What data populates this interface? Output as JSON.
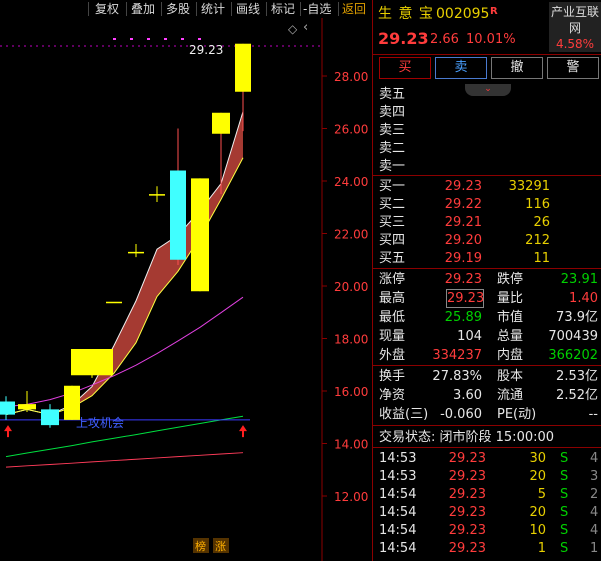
{
  "toolbar": {
    "items": [
      "复权",
      "叠加",
      "多股",
      "统计",
      "画线",
      "标记",
      "-自选",
      "返回"
    ]
  },
  "chart_data": {
    "type": "candlestick",
    "y_ticks": [
      "28.00",
      "26.00",
      "24.00",
      "22.00",
      "20.00",
      "18.00",
      "16.00",
      "14.00",
      "12.00"
    ],
    "ylim": [
      11,
      29.7
    ],
    "last_price_label": "29.23",
    "annotation": "上攻机会",
    "bottom_tags": [
      "榜",
      "涨"
    ],
    "colors": {
      "up": "#ffff00",
      "down": "#40ffff",
      "ribbon": "#a53a32",
      "ma_pink": "#e040e0",
      "ma_green": "#00e040",
      "ma_red": "#ff3c5a",
      "line_blue": "#3a3aff",
      "arrow": "#ff2020"
    },
    "candles": [
      {
        "o": 15.6,
        "c": 15.1,
        "h": 15.8,
        "l": 14.9
      },
      {
        "o": 15.3,
        "c": 15.5,
        "h": 16.0,
        "l": 15.2
      },
      {
        "o": 15.3,
        "c": 14.7,
        "h": 15.5,
        "l": 14.6
      },
      {
        "o": 14.9,
        "c": 16.2,
        "h": 16.2,
        "l": 14.9
      },
      {
        "o": 16.6,
        "c": 17.6,
        "h": 17.6,
        "l": 16.5
      },
      {
        "o": 19.4,
        "c": 19.4,
        "h": 19.4,
        "l": 19.4
      },
      {
        "o": 21.3,
        "c": 21.3,
        "h": 21.6,
        "l": 21.1
      },
      {
        "o": 23.5,
        "c": 23.5,
        "h": 23.8,
        "l": 23.2
      },
      {
        "o": 24.4,
        "c": 21.0,
        "h": 26.0,
        "l": 20.8
      },
      {
        "o": 19.8,
        "c": 24.1,
        "h": 24.1,
        "l": 19.8
      },
      {
        "o": 25.8,
        "c": 26.6,
        "h": 26.6,
        "l": 23.5
      },
      {
        "o": 27.4,
        "c": 29.23,
        "h": 29.23,
        "l": 25.9
      }
    ]
  },
  "stock": {
    "name": "生 意 宝",
    "code": "002095",
    "badge": "R",
    "price": "29.23",
    "change": "2.66",
    "change_pct": "10.01%",
    "sector_name": "产业互联网",
    "sector_pct": "4.58%"
  },
  "buttons": [
    "买",
    "卖",
    "撤",
    "警"
  ],
  "sell_levels": [
    {
      "label": "卖五"
    },
    {
      "label": "卖四"
    },
    {
      "label": "卖三"
    },
    {
      "label": "卖二"
    },
    {
      "label": "卖一"
    }
  ],
  "buy_levels": [
    {
      "label": "买一",
      "price": "29.23",
      "vol": "33291"
    },
    {
      "label": "买二",
      "price": "29.22",
      "vol": "116"
    },
    {
      "label": "买三",
      "price": "29.21",
      "vol": "26"
    },
    {
      "label": "买四",
      "price": "29.20",
      "vol": "212"
    },
    {
      "label": "买五",
      "price": "29.19",
      "vol": "11"
    }
  ],
  "stats": [
    {
      "l1": "涨停",
      "v1": "29.23",
      "c1": "red",
      "l2": "跌停",
      "v2": "23.91",
      "c2": "green"
    },
    {
      "l1": "最高",
      "v1": "29.23",
      "c1": "red",
      "l2": "量比",
      "v2": "1.40",
      "c2": "red"
    },
    {
      "l1": "最低",
      "v1": "25.89",
      "c1": "green",
      "l2": "市值",
      "v2": "73.9亿",
      "c2": "white"
    },
    {
      "l1": "现量",
      "v1": "104",
      "c1": "white",
      "l2": "总量",
      "v2": "700439",
      "c2": "white"
    },
    {
      "l1": "外盘",
      "v1": "334237",
      "c1": "red",
      "l2": "内盘",
      "v2": "366202",
      "c2": "green"
    }
  ],
  "stats2": [
    {
      "l1": "换手",
      "v1": "27.83%",
      "l2": "股本",
      "v2": "2.53亿"
    },
    {
      "l1": "净资",
      "v1": "3.60",
      "l2": "流通",
      "v2": "2.52亿"
    },
    {
      "l1": "收益(三)",
      "v1": "-0.060",
      "l2": "PE(动)",
      "v2": "--"
    }
  ],
  "trade_status": "交易状态: 闭市阶段 15:00:00",
  "ticks": [
    {
      "time": "14:53",
      "price": "29.23",
      "vol": "30",
      "side": "S",
      "n": "4"
    },
    {
      "time": "14:53",
      "price": "29.23",
      "vol": "20",
      "side": "S",
      "n": "3"
    },
    {
      "time": "14:54",
      "price": "29.23",
      "vol": "5",
      "side": "S",
      "n": "2"
    },
    {
      "time": "14:54",
      "price": "29.23",
      "vol": "20",
      "side": "S",
      "n": "4"
    },
    {
      "time": "14:54",
      "price": "29.23",
      "vol": "10",
      "side": "S",
      "n": "4"
    },
    {
      "time": "14:54",
      "price": "29.23",
      "vol": "1",
      "side": "S",
      "n": "1"
    }
  ]
}
